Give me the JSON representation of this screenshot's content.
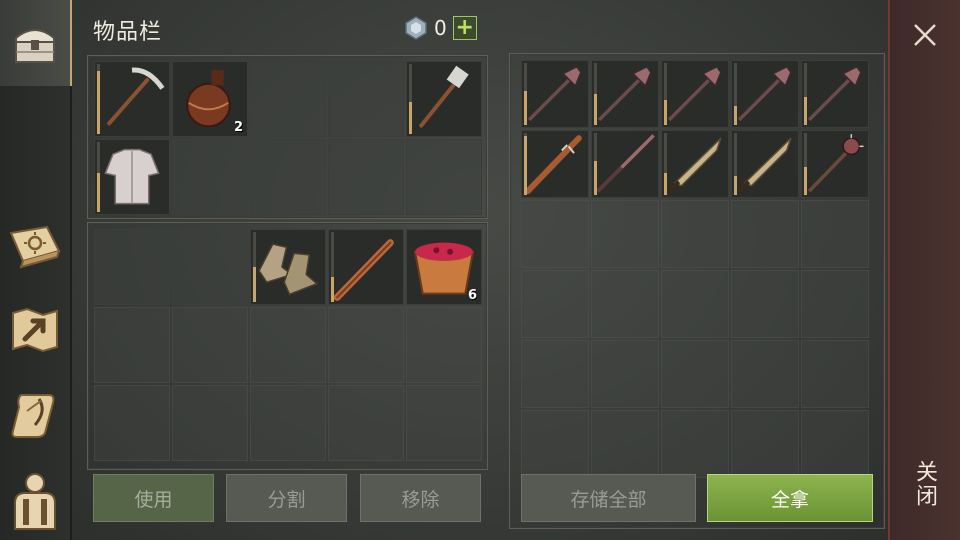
{
  "inventory": {
    "title": "物品栏",
    "currency_value": "0",
    "add_currency": "+",
    "slots": [
      {
        "item": "pickaxe-icon",
        "durability": 0.9,
        "qty": ""
      },
      {
        "item": "flask-icon",
        "durability": null,
        "qty": "2"
      },
      {
        "item": null
      },
      {
        "item": null
      },
      {
        "item": "hatchet-icon",
        "durability": 0.45,
        "qty": ""
      },
      {
        "item": "shirt-icon",
        "durability": 0.55,
        "qty": ""
      },
      {
        "item": null
      },
      {
        "item": null
      },
      {
        "item": null
      },
      {
        "item": null
      }
    ],
    "bag_slots": [
      {
        "item": null
      },
      {
        "item": null
      },
      {
        "item": "boots-icon",
        "durability": 0.5,
        "qty": ""
      },
      {
        "item": "club-icon",
        "durability": 0.35,
        "qty": ""
      },
      {
        "item": "berry-bowl-icon",
        "durability": null,
        "qty": "6"
      }
    ],
    "buttons": {
      "use": "使用",
      "split": "分割",
      "remove": "移除"
    }
  },
  "storage": {
    "slots": [
      {
        "item": "mace-icon",
        "durability": 0.55
      },
      {
        "item": "mace-icon",
        "durability": 0.5
      },
      {
        "item": "mace-icon",
        "durability": 0.4
      },
      {
        "item": "mace-icon",
        "durability": 0.3
      },
      {
        "item": "mace-icon",
        "durability": 0.45
      },
      {
        "item": "spiked-club-icon",
        "durability": 0.95
      },
      {
        "item": "spear-icon",
        "durability": 0.55
      },
      {
        "item": "machete-icon",
        "durability": 0.35
      },
      {
        "item": "machete-icon",
        "durability": 0.3
      },
      {
        "item": "spiked-mace-icon",
        "durability": 0.45
      }
    ],
    "buttons": {
      "store_all": "存储全部",
      "take_all": "全拿"
    }
  },
  "sidebar": [
    "chest-icon",
    "crafting-book-icon",
    "map-icon",
    "quest-scroll-icon",
    "character-icon"
  ],
  "close_label": "关闭",
  "colors": {
    "accent_green": "#8db44e",
    "durability": "#c8a66a",
    "close_bg": "#4b322f"
  }
}
